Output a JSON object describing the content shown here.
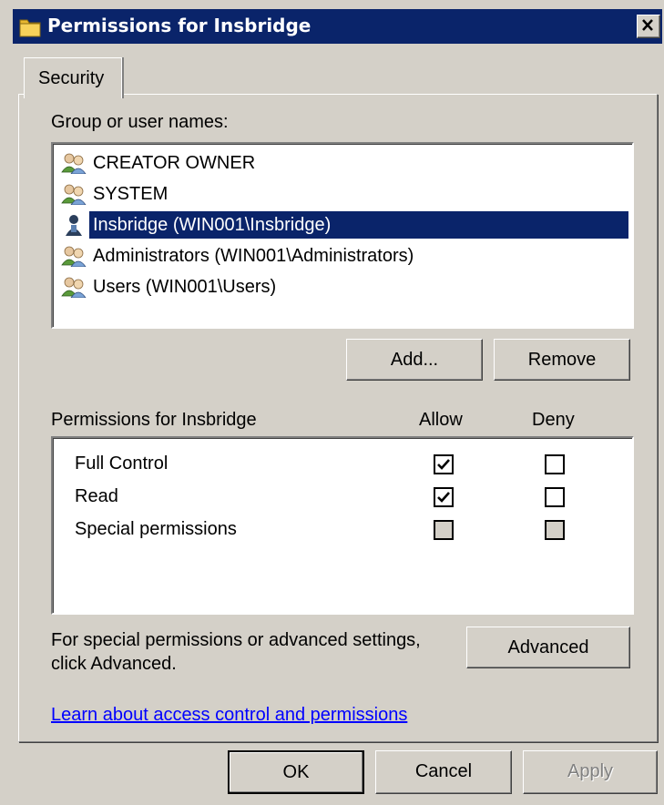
{
  "window": {
    "title": "Permissions for Insbridge",
    "close_glyph": "×"
  },
  "tabs": [
    {
      "label": "Security",
      "selected": true
    }
  ],
  "users": {
    "heading": "Group or user names:",
    "items": [
      {
        "label": "CREATOR OWNER",
        "icon": "group-icon",
        "selected": false
      },
      {
        "label": "SYSTEM",
        "icon": "group-icon",
        "selected": false
      },
      {
        "label": "Insbridge (WIN001\\Insbridge)",
        "icon": "user-icon",
        "selected": true
      },
      {
        "label": "Administrators (WIN001\\Administrators)",
        "icon": "group-icon",
        "selected": false
      },
      {
        "label": "Users (WIN001\\Users)",
        "icon": "group-icon",
        "selected": false
      }
    ],
    "add_label": "Add...",
    "remove_label": "Remove"
  },
  "permissions": {
    "heading": "Permissions for Insbridge",
    "allow_header": "Allow",
    "deny_header": "Deny",
    "rows": [
      {
        "name": "Full Control",
        "allow": true,
        "deny": false,
        "enabled": true
      },
      {
        "name": "Read",
        "allow": true,
        "deny": false,
        "enabled": true
      },
      {
        "name": "Special permissions",
        "allow": false,
        "deny": false,
        "enabled": false
      }
    ]
  },
  "advanced": {
    "hint_line1": "For special permissions or advanced settings,",
    "hint_line2": "click Advanced.",
    "button_label": "Advanced"
  },
  "help_link": "Learn about access control and permissions",
  "footer": {
    "ok_label": "OK",
    "cancel_label": "Cancel",
    "apply_label": "Apply"
  },
  "colors": {
    "titlebar": "#0a246a",
    "dialog_bg": "#d4d0c8",
    "selection": "#0a246a",
    "link": "#0000ff"
  }
}
